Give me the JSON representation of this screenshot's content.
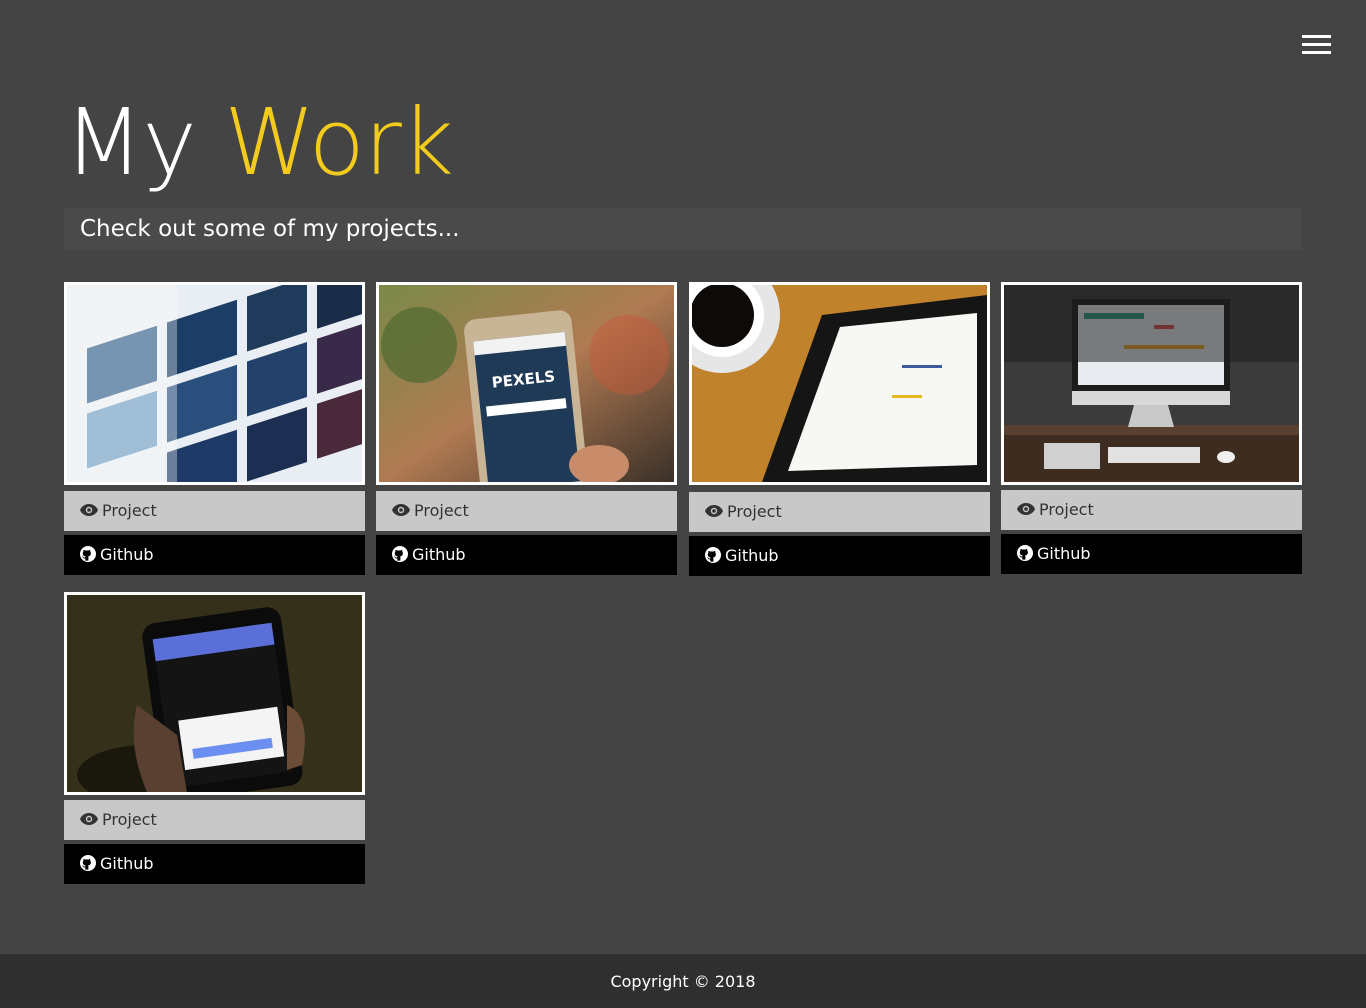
{
  "header": {
    "title_part1": "My",
    "title_part2": "Work",
    "accent_color": "#f2cb1d",
    "menu_icon": "hamburger-icon"
  },
  "intro": {
    "subtitle": "Check out some of my projects..."
  },
  "projects": [
    {
      "project_label": "Project",
      "github_label": "Github",
      "image": "streaming-app-tiles-photo"
    },
    {
      "project_label": "Project",
      "github_label": "Github",
      "image": "phone-pexels-site-photo"
    },
    {
      "project_label": "Project",
      "github_label": "Github",
      "image": "tablet-with-coffee-photo"
    },
    {
      "project_label": "Project",
      "github_label": "Github",
      "image": "imac-desk-setup-photo"
    },
    {
      "project_label": "Project",
      "github_label": "Github",
      "image": "phone-in-hand-dark-photo"
    }
  ],
  "footer": {
    "copyright": "Copyright © 2018"
  }
}
